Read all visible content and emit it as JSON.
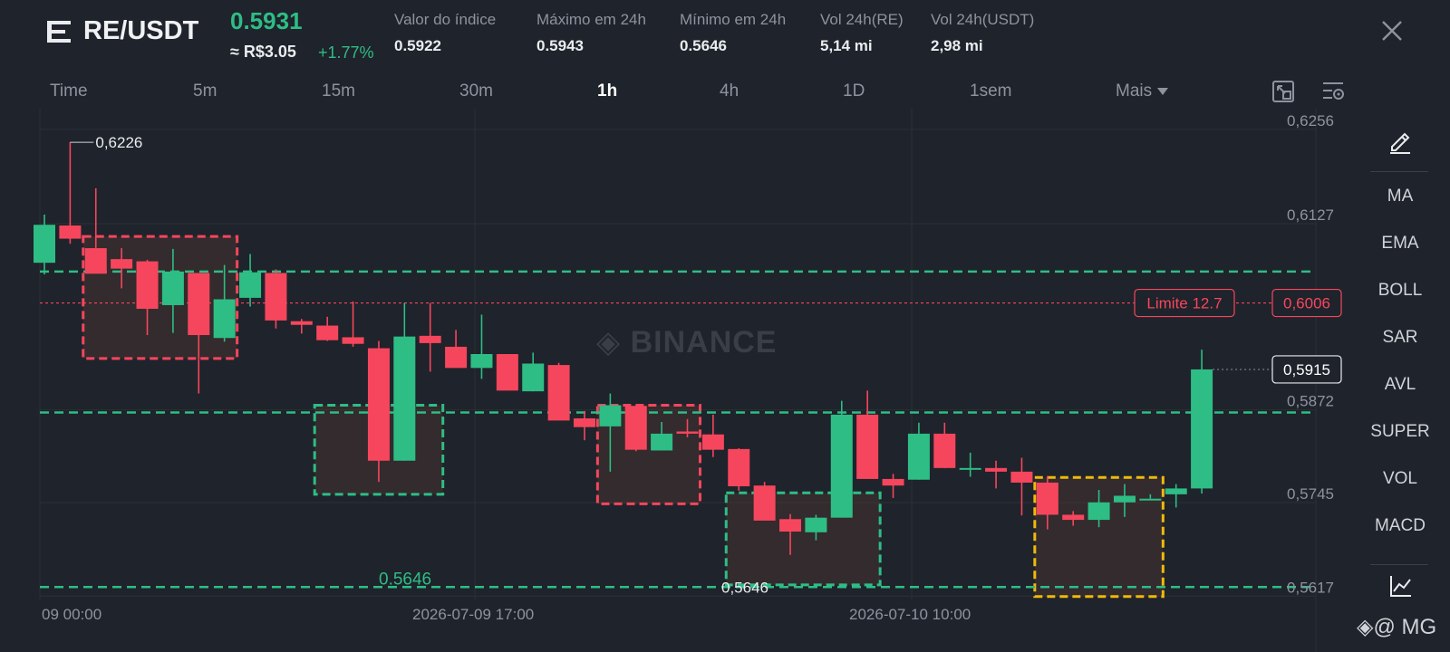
{
  "header": {
    "pair": "RE/USDT",
    "price": "0.5931",
    "fiat_price": "≈ R$3.05",
    "change": "+1.77%",
    "stats": [
      {
        "label": "Valor do índice",
        "value": "0.5922"
      },
      {
        "label": "Máximo em 24h",
        "value": "0.5943"
      },
      {
        "label": "Mínimo em 24h",
        "value": "0.5646"
      },
      {
        "label": "Vol 24h(RE)",
        "value": "5,14 mi"
      },
      {
        "label": "Vol 24h(USDT)",
        "value": "2,98 mi"
      }
    ]
  },
  "tabs": [
    "Time",
    "5m",
    "15m",
    "30m",
    "1h",
    "4h",
    "1D",
    "1sem",
    "Mais"
  ],
  "active_tab": "1h",
  "sidebar": {
    "items": [
      "MA",
      "EMA",
      "BOLL",
      "SAR",
      "AVL",
      "SUPER",
      "VOL",
      "MACD"
    ],
    "icons": [
      "pencil-icon",
      "chart-line-icon"
    ]
  },
  "watermark": {
    "brand": "BINANCE",
    "user": "@ MG"
  },
  "colors": {
    "up": "#2ebd85",
    "down": "#f6465d",
    "zone_yellow": "#f0b90b",
    "background": "#1f232b"
  },
  "chart_data": {
    "type": "candlestick",
    "y_ticks": [
      0.6256,
      0.6127,
      0.5872,
      0.5745,
      0.5617
    ],
    "x_ticks": [
      "09 00:00",
      "2026-07-09 17:00",
      "2026-07-10 10:00"
    ],
    "ylim": [
      0.56,
      0.6272
    ],
    "high_label": "0,6226",
    "low_label": "0,5646",
    "low_label_left": "0.5646",
    "last_price_label": "0,5915",
    "limit_order": {
      "label": "Limite 12.7",
      "price_label": "0,6006",
      "price": 0.6006
    },
    "support_resistance_lines": [
      0.6049,
      0.5856,
      0.5617
    ],
    "zones": [
      {
        "x0": 2,
        "x1": 7,
        "y0": 0.6097,
        "y1": 0.593,
        "color": "red"
      },
      {
        "x0": 11,
        "x1": 15,
        "y0": 0.5866,
        "y1": 0.5744,
        "color": "green"
      },
      {
        "x0": 22,
        "x1": 25,
        "y0": 0.5866,
        "y1": 0.5731,
        "color": "red"
      },
      {
        "x0": 27,
        "x1": 32,
        "y0": 0.5746,
        "y1": 0.562,
        "color": "green"
      },
      {
        "x0": 39,
        "x1": 43,
        "y0": 0.5767,
        "y1": 0.5604,
        "color": "yellow"
      }
    ],
    "candles": [
      [
        0.6061,
        0.6127,
        0.6045,
        0.6113
      ],
      [
        0.6112,
        0.6226,
        0.6087,
        0.6094
      ],
      [
        0.6081,
        0.6163,
        0.6047,
        0.6046
      ],
      [
        0.6066,
        0.6081,
        0.6026,
        0.6053
      ],
      [
        0.6063,
        0.6065,
        0.5962,
        0.5998
      ],
      [
        0.6003,
        0.608,
        0.5965,
        0.6049
      ],
      [
        0.6047,
        0.6047,
        0.5882,
        0.5962
      ],
      [
        0.5958,
        0.6058,
        0.5953,
        0.6011
      ],
      [
        0.6013,
        0.6073,
        0.6001,
        0.6048
      ],
      [
        0.6047,
        0.6052,
        0.5971,
        0.5982
      ],
      [
        0.5981,
        0.5984,
        0.5964,
        0.5976
      ],
      [
        0.5975,
        0.5987,
        0.5954,
        0.5955
      ],
      [
        0.5959,
        0.6008,
        0.5946,
        0.595
      ],
      [
        0.5944,
        0.5954,
        0.5761,
        0.579
      ],
      [
        0.579,
        0.6006,
        0.579,
        0.596
      ],
      [
        0.5961,
        0.6006,
        0.5912,
        0.5951
      ],
      [
        0.5946,
        0.5969,
        0.5924,
        0.5917
      ],
      [
        0.5917,
        0.599,
        0.5902,
        0.5936
      ],
      [
        0.5936,
        0.5936,
        0.5889,
        0.5886
      ],
      [
        0.5885,
        0.5938,
        0.5885,
        0.5923
      ],
      [
        0.5921,
        0.5924,
        0.5855,
        0.5845
      ],
      [
        0.5848,
        0.5858,
        0.5818,
        0.5836
      ],
      [
        0.5837,
        0.5882,
        0.5775,
        0.5866
      ],
      [
        0.5865,
        0.5865,
        0.5803,
        0.5805
      ],
      [
        0.5804,
        0.5843,
        0.5804,
        0.5827
      ],
      [
        0.583,
        0.5847,
        0.5822,
        0.5827
      ],
      [
        0.5826,
        0.5853,
        0.5795,
        0.5805
      ],
      [
        0.5806,
        0.5807,
        0.5749,
        0.5755
      ],
      [
        0.5756,
        0.5761,
        0.572,
        0.5708
      ],
      [
        0.571,
        0.5717,
        0.5661,
        0.5693
      ],
      [
        0.5692,
        0.5716,
        0.5681,
        0.5712
      ],
      [
        0.5712,
        0.5872,
        0.5712,
        0.5853
      ],
      [
        0.5853,
        0.5886,
        0.577,
        0.5765
      ],
      [
        0.5765,
        0.5772,
        0.5739,
        0.5756
      ],
      [
        0.5764,
        0.5842,
        0.5764,
        0.5827
      ],
      [
        0.5827,
        0.5842,
        0.578,
        0.578
      ],
      [
        0.578,
        0.5801,
        0.5768,
        0.578
      ],
      [
        0.578,
        0.579,
        0.5752,
        0.5775
      ],
      [
        0.5775,
        0.5794,
        0.5715,
        0.576
      ],
      [
        0.576,
        0.5769,
        0.5696,
        0.5716
      ],
      [
        0.5716,
        0.5721,
        0.5701,
        0.5709
      ],
      [
        0.5709,
        0.575,
        0.5699,
        0.5733
      ],
      [
        0.5733,
        0.5758,
        0.5713,
        0.5742
      ],
      [
        0.5738,
        0.5744,
        0.5738,
        0.5738
      ],
      [
        0.5744,
        0.5758,
        0.5726,
        0.5752
      ],
      [
        0.5752,
        0.5942,
        0.5745,
        0.5915
      ]
    ]
  }
}
